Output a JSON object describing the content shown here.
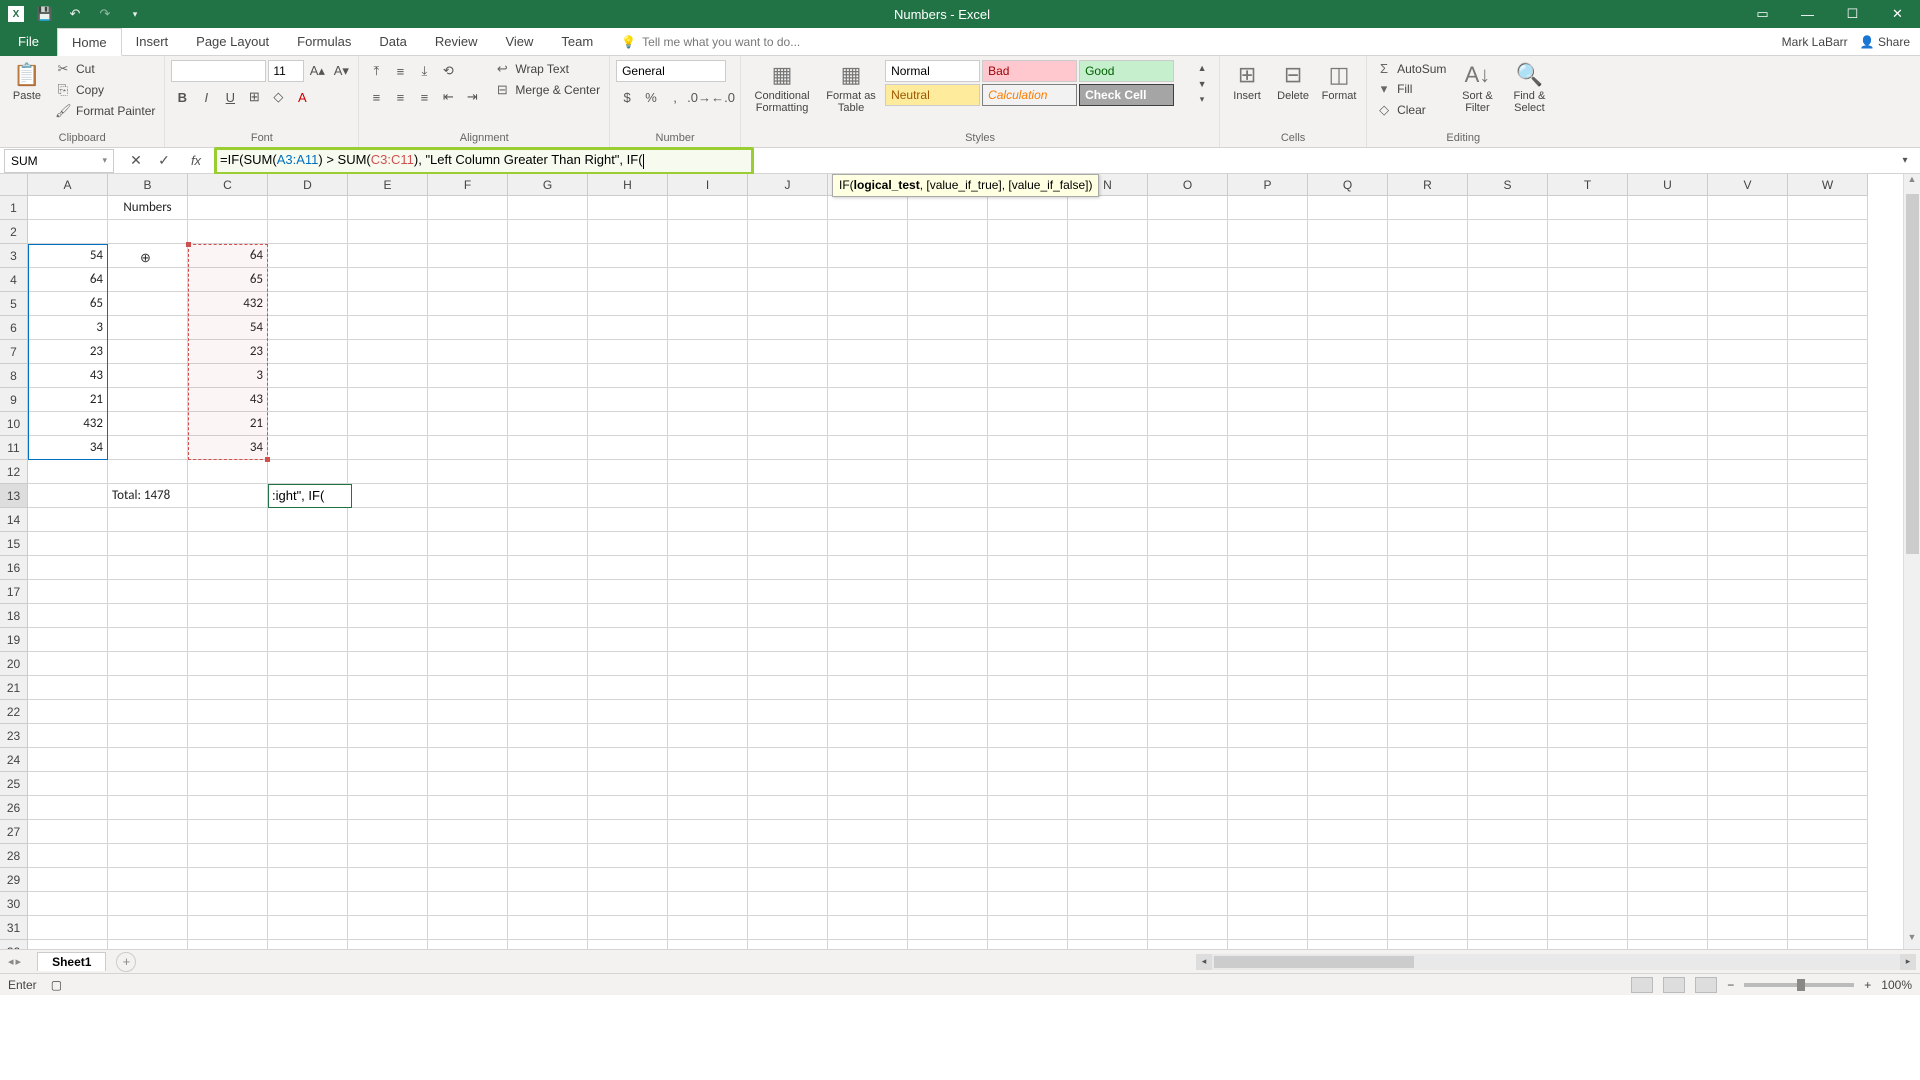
{
  "window": {
    "title": "Numbers - Excel"
  },
  "user": {
    "name": "Mark LaBarr",
    "share": "Share"
  },
  "tabs": [
    "File",
    "Home",
    "Insert",
    "Page Layout",
    "Formulas",
    "Data",
    "Review",
    "View",
    "Team"
  ],
  "active_tab": "Home",
  "tell_me": "Tell me what you want to do...",
  "ribbon": {
    "clipboard": {
      "label": "Clipboard",
      "paste": "Paste",
      "cut": "Cut",
      "copy": "Copy",
      "format_painter": "Format Painter"
    },
    "font": {
      "label": "Font",
      "name": "",
      "size": "11"
    },
    "alignment": {
      "label": "Alignment",
      "wrap": "Wrap Text",
      "merge": "Merge & Center"
    },
    "number": {
      "label": "Number",
      "format": "General"
    },
    "styles": {
      "label": "Styles",
      "cond": "Conditional Formatting",
      "fat": "Format as Table",
      "s1": "Normal",
      "s2": "Bad",
      "s3": "Good",
      "s4": "Neutral",
      "s5": "Calculation",
      "s6": "Check Cell"
    },
    "cells": {
      "label": "Cells",
      "insert": "Insert",
      "delete": "Delete",
      "format": "Format"
    },
    "editing": {
      "label": "Editing",
      "autosum": "AutoSum",
      "fill": "Fill",
      "clear": "Clear",
      "sortfilter": "Sort & Filter",
      "findselect": "Find & Select"
    }
  },
  "name_box": "SUM",
  "formula": {
    "prefix": "=IF(SUM(",
    "ref_a": "A3:A11",
    "mid1": ") > SUM(",
    "ref_c": "C3:C11",
    "mid2": "), \"Left Column Greater Than Right\", IF("
  },
  "tooltip_if": "IF(logical_test, [value_if_true], [value_if_false])",
  "columns": [
    "A",
    "B",
    "C",
    "D",
    "E",
    "F",
    "G",
    "H",
    "I",
    "J",
    "K",
    "L",
    "M",
    "N",
    "O",
    "P",
    "Q",
    "R",
    "S",
    "T",
    "U",
    "V",
    "W"
  ],
  "rows": 32,
  "data": {
    "b1": "Numbers",
    "a": [
      54,
      64,
      65,
      3,
      23,
      43,
      21,
      432,
      34
    ],
    "c": [
      64,
      65,
      432,
      54,
      23,
      3,
      43,
      21,
      34
    ],
    "b3_cursor": "⊕",
    "total_label": "Total: 1478",
    "d13_edit": ":ight\", IF("
  },
  "sheet": {
    "tab": "Sheet1"
  },
  "status": {
    "mode": "Enter",
    "zoom": "100%"
  }
}
